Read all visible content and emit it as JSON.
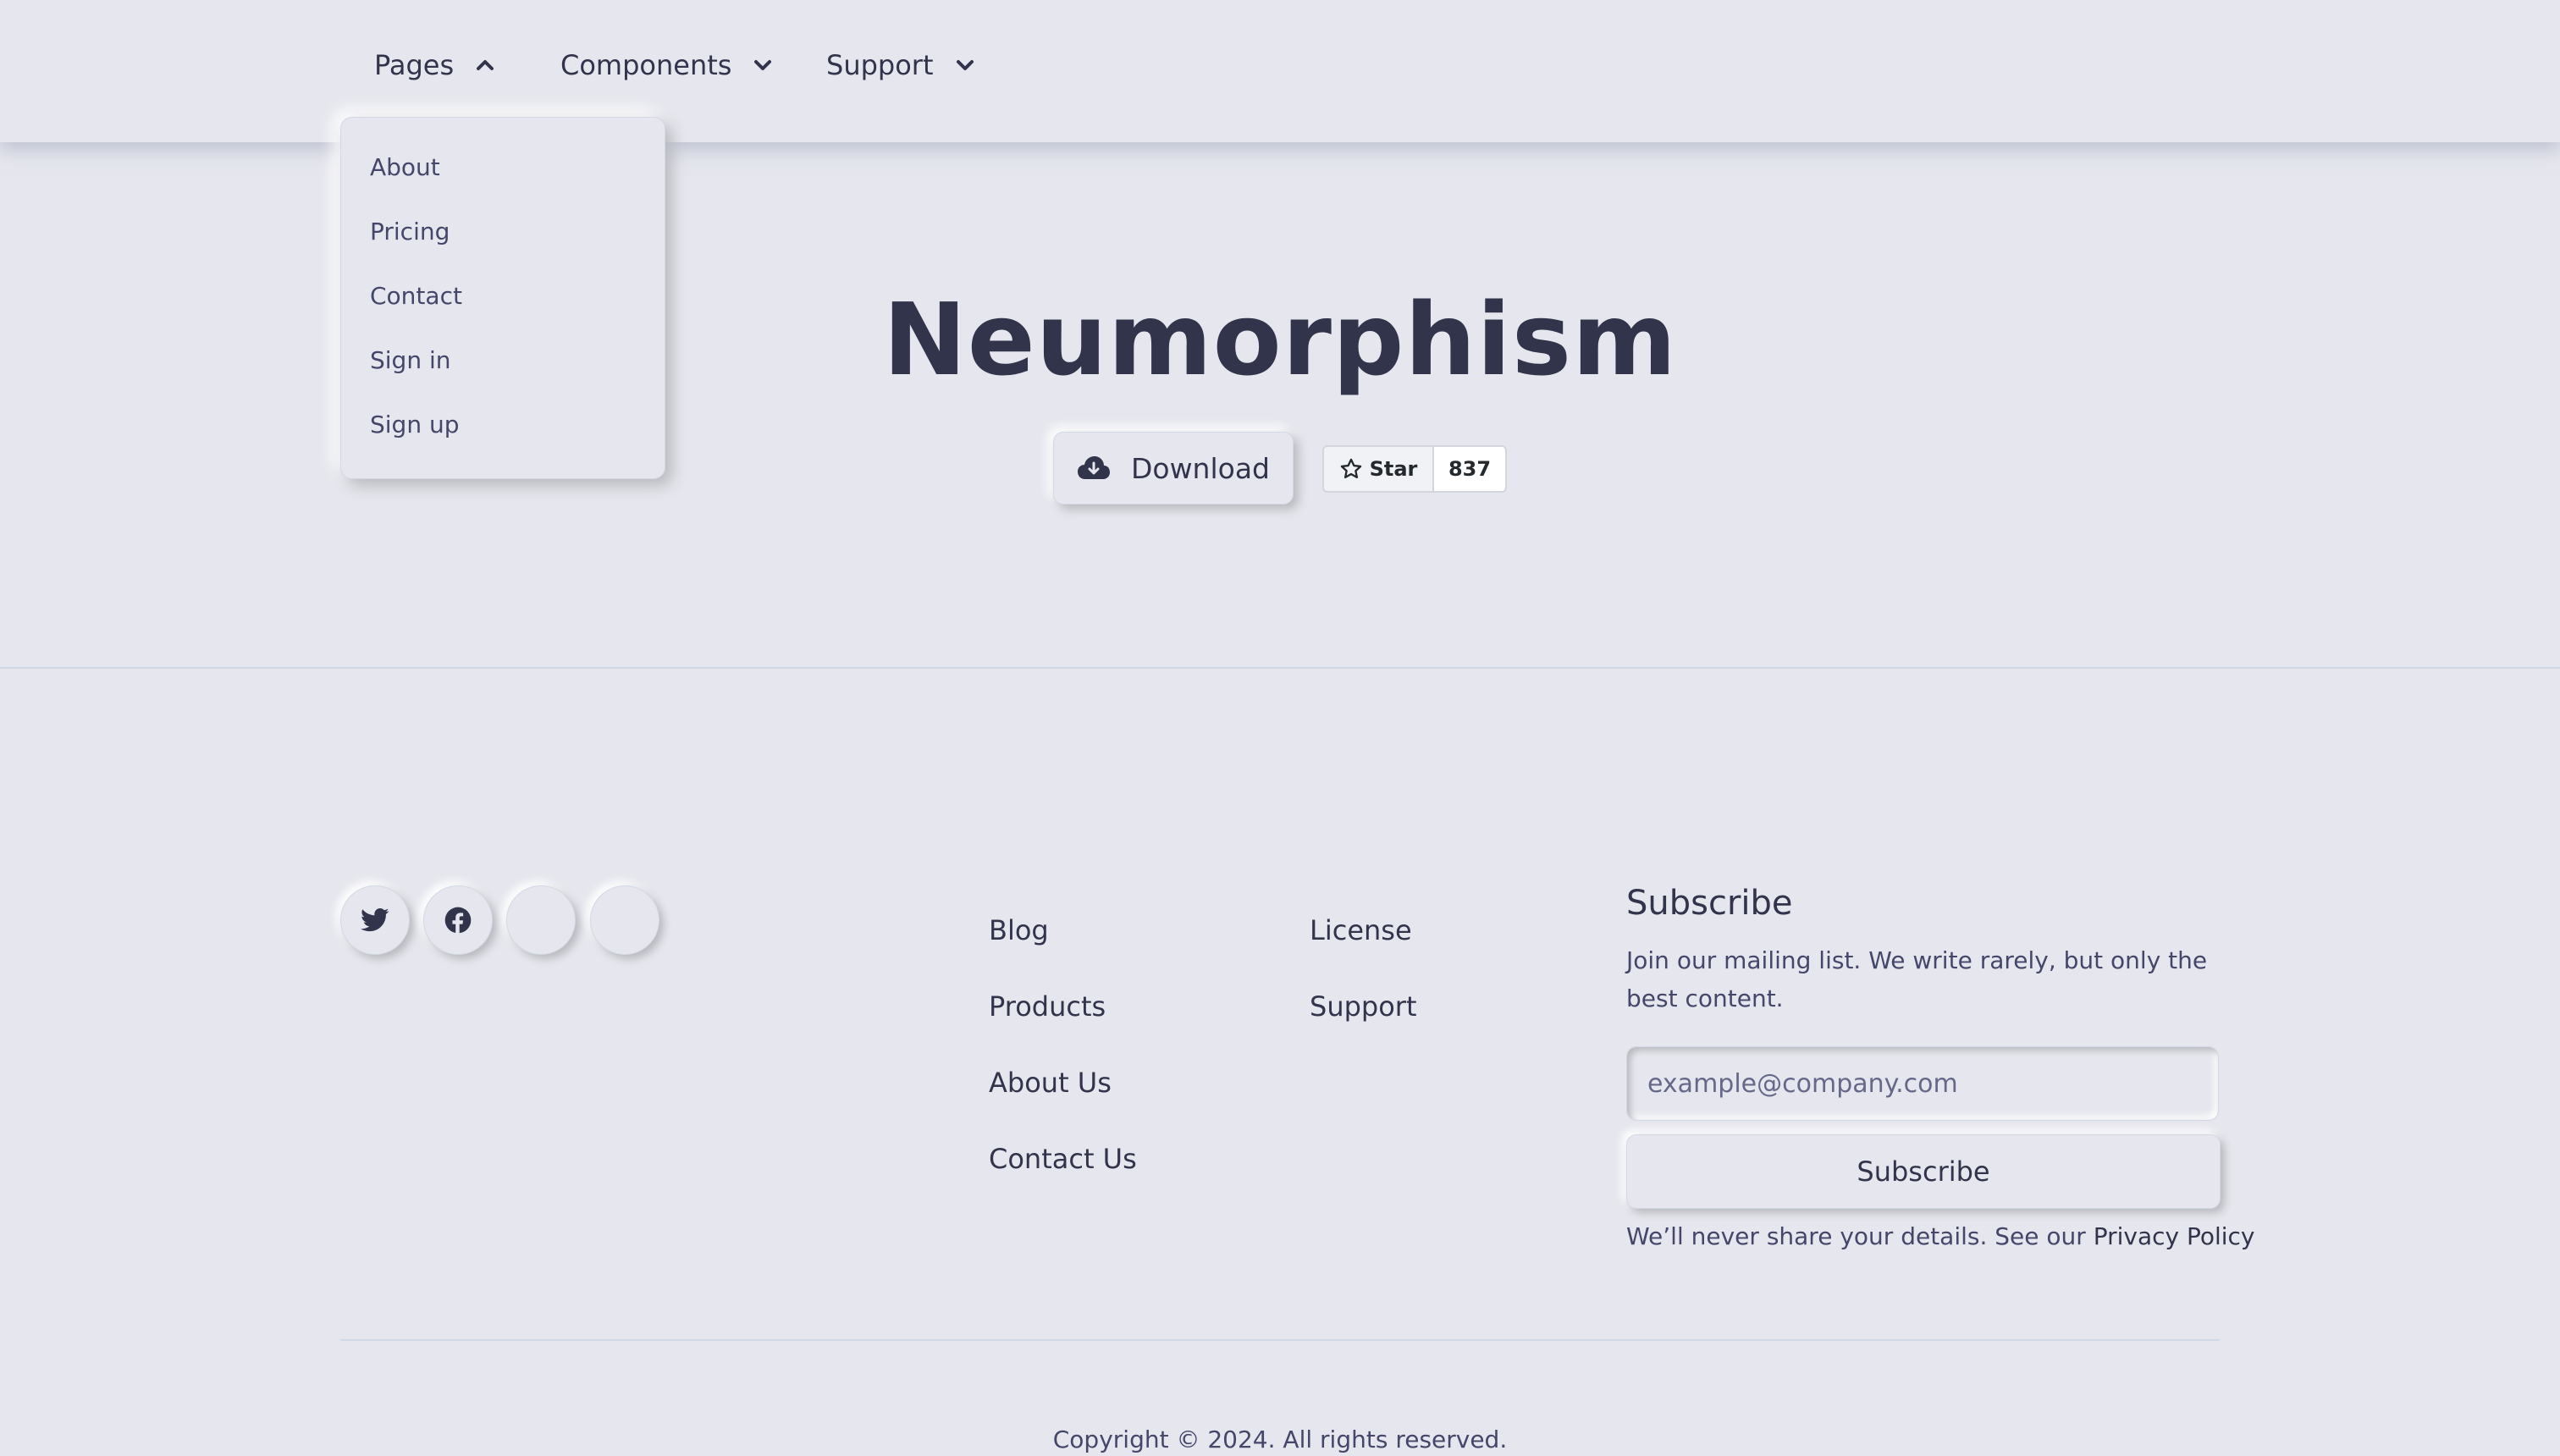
{
  "nav": {
    "items": [
      {
        "label": "Pages",
        "icon": "chevron-up-icon"
      },
      {
        "label": "Components",
        "icon": "chevron-down-icon"
      },
      {
        "label": "Support",
        "icon": "chevron-down-icon"
      }
    ]
  },
  "dropdown": {
    "items": [
      "About",
      "Pricing",
      "Contact",
      "Sign in",
      "Sign up"
    ]
  },
  "hero": {
    "title": "Neumorphism",
    "download_label": "Download",
    "download_icon": "cloud-download-icon",
    "github": {
      "star_label": "Star",
      "count": "837",
      "icon": "star-icon"
    }
  },
  "footer": {
    "social": [
      "twitter-icon",
      "facebook-icon",
      "blank-social-icon",
      "blank-social-icon"
    ],
    "links_col1": [
      "Blog",
      "Products",
      "About Us",
      "Contact Us"
    ],
    "links_col2": [
      "License",
      "Support"
    ],
    "subscribe": {
      "title": "Subscribe",
      "description": "Join our mailing list. We write rarely, but only the best content.",
      "placeholder": "example@company.com",
      "button_label": "Subscribe",
      "note": "We’ll never share your details. See our ",
      "privacy_link": "Privacy Policy"
    },
    "copyright": "Copyright © 2024. All rights reserved."
  },
  "colors": {
    "background": "#e6e7ee",
    "text": "#31344b",
    "muted_text": "#44476a",
    "shadow_dark": "#b8b9be",
    "shadow_light": "#ffffff"
  }
}
